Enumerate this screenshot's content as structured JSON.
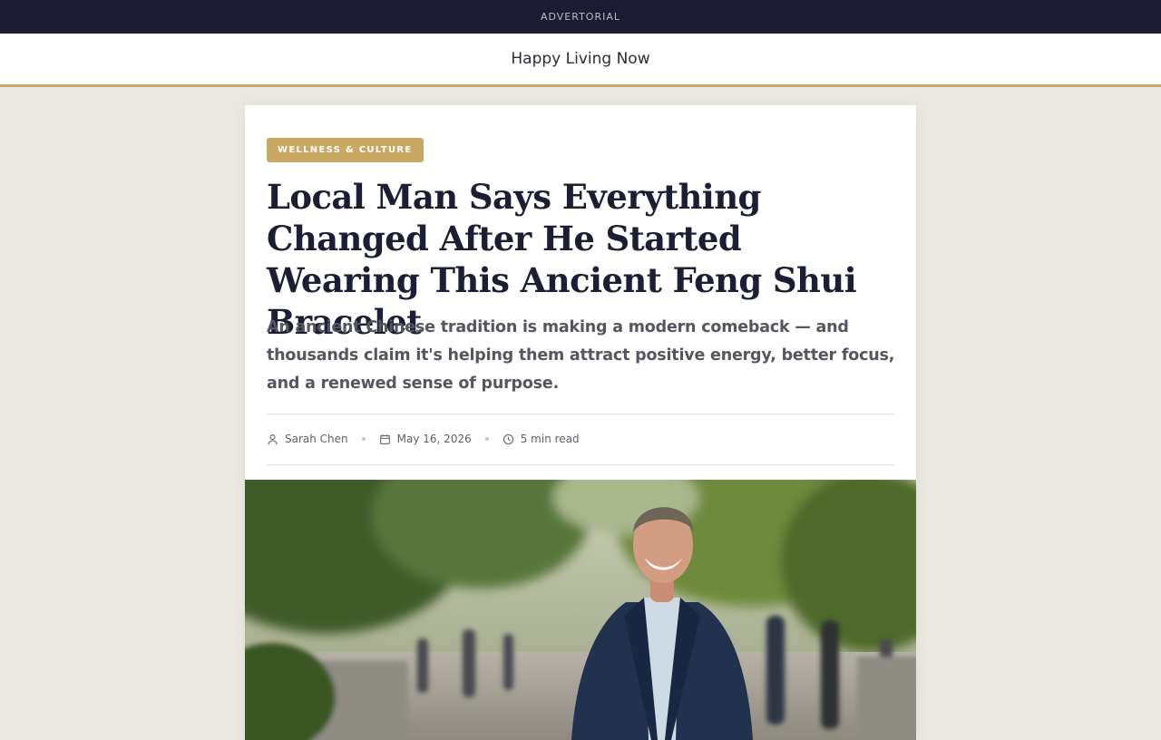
{
  "topbar": {
    "label": "ADVERTORIAL"
  },
  "site": {
    "name": "Happy Living Now"
  },
  "article": {
    "category": "WELLNESS & CULTURE",
    "headline": "Local Man Says Everything Changed After He Started Wearing This Ancient Feng Shui Bracelet",
    "dek": "An ancient Chinese tradition is making a modern comeback — and thousands claim it's helping them attract positive energy, better focus, and a renewed sense of purpose.",
    "author": "Sarah Chen",
    "date": "May 16, 2026",
    "read_time": "5 min read"
  },
  "icons": {
    "author": "user-icon",
    "date": "calendar-icon",
    "read_time": "clock-icon"
  },
  "colors": {
    "topbar": "#1c1d33",
    "accent": "#c9a862",
    "page_bg": "#ebe8e2",
    "headline": "#1c1f33"
  }
}
